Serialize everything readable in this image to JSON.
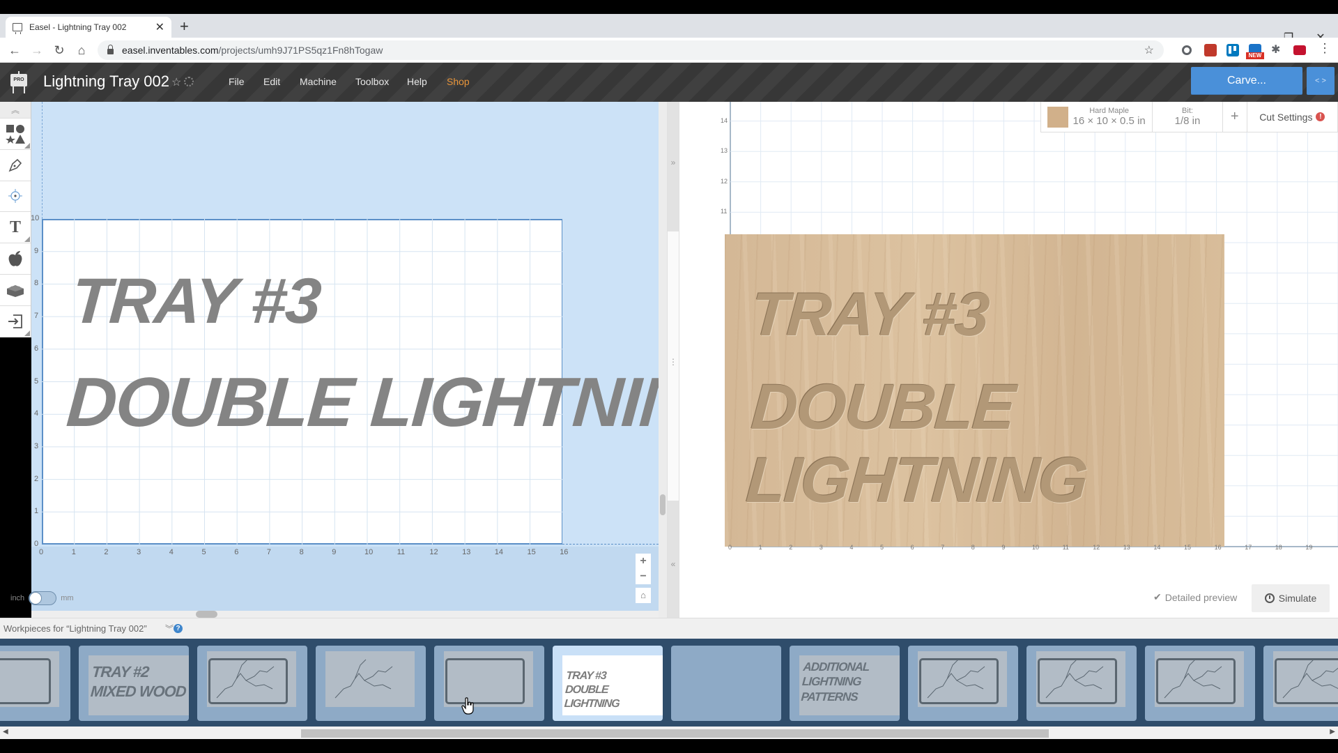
{
  "browser": {
    "tab_title": "Easel - Lightning Tray 002",
    "url_host": "easel.inventables.com",
    "url_path": "/projects/umh9J71PS5qz1Fn8hTogaw",
    "extensions": [
      {
        "name": "circle-extension-icon",
        "color": "#5f6368"
      },
      {
        "name": "chart-extension-icon",
        "color": "#c0392b"
      },
      {
        "name": "trello-extension-icon",
        "color": "#0079bf"
      },
      {
        "name": "new-extension-icon",
        "color": "#1a73c8",
        "badge": "NEW"
      },
      {
        "name": "puzzle-extension-icon",
        "color": "#5f6368"
      },
      {
        "name": "red-extension-icon",
        "color": "#c4122f"
      }
    ]
  },
  "app": {
    "logo_badge": "PRO",
    "project_title": "Lightning Tray 002",
    "menu": [
      "File",
      "Edit",
      "Machine",
      "Toolbox",
      "Help",
      "Shop"
    ],
    "shop_color": "#e8953a",
    "carve_label": "Carve...",
    "accent": "#4a90d9"
  },
  "tools": [
    {
      "name": "shapes-tool",
      "has_menu": true
    },
    {
      "name": "pen-tool",
      "has_menu": false
    },
    {
      "name": "point-tool",
      "has_menu": false
    },
    {
      "name": "text-tool",
      "has_menu": true
    },
    {
      "name": "icon-library-tool",
      "has_menu": false
    },
    {
      "name": "apps-tool",
      "has_menu": false
    },
    {
      "name": "import-tool",
      "has_menu": true
    }
  ],
  "design": {
    "x_ticks": [
      "0",
      "1",
      "2",
      "3",
      "4",
      "5",
      "6",
      "7",
      "8",
      "9",
      "10",
      "11",
      "12",
      "13",
      "14",
      "15",
      "16"
    ],
    "y_ticks": [
      "0",
      "1",
      "2",
      "3",
      "4",
      "5",
      "6",
      "7",
      "8",
      "9",
      "10"
    ],
    "line1": "TRAY #3",
    "line2": "DOUBLE LIGHTNING",
    "unit_left": "inch",
    "unit_right": "mm",
    "unit_selected": "inch",
    "zoom_in": "+",
    "zoom_out": "−"
  },
  "material": {
    "name": "Hard Maple",
    "dimensions": "16 × 10 × 0.5 in",
    "bit_label": "Bit:",
    "bit_value": "1/8 in",
    "add_label": "+",
    "cut_settings_label": "Cut Settings",
    "warning": "!"
  },
  "preview": {
    "x_ticks": [
      "0",
      "1",
      "2",
      "3",
      "4",
      "5",
      "6",
      "7",
      "8",
      "9",
      "10",
      "11",
      "12",
      "13",
      "14",
      "15",
      "16",
      "17",
      "18",
      "19"
    ],
    "y_ticks": [
      "11",
      "12",
      "13",
      "14"
    ],
    "y_partial": "1",
    "line1": "TRAY #3",
    "line2": "DOUBLE LIGHTNING",
    "detailed_preview_label": "Detailed preview",
    "detailed_preview_checked": true,
    "simulate_label": "Simulate"
  },
  "workpieces": {
    "label": "Workpieces for “Lightning Tray 002”",
    "help": "?",
    "items": [
      {
        "type": "frame",
        "label": ""
      },
      {
        "type": "text",
        "label": "TRAY #2\nMIXED WOOD"
      },
      {
        "type": "lightning-frame",
        "label": ""
      },
      {
        "type": "lightning",
        "label": ""
      },
      {
        "type": "frame",
        "label": ""
      },
      {
        "type": "text",
        "label": "TRAY #3\nDOUBLE LIGHTNING",
        "active": true
      },
      {
        "type": "empty",
        "label": ""
      },
      {
        "type": "text",
        "label": "ADDITIONAL\nLIGHTNING\nPATTERNS"
      },
      {
        "type": "lightning-frame",
        "label": ""
      },
      {
        "type": "lightning-frame",
        "label": ""
      },
      {
        "type": "lightning-frame",
        "label": ""
      },
      {
        "type": "lightning-frame",
        "label": ""
      }
    ]
  }
}
